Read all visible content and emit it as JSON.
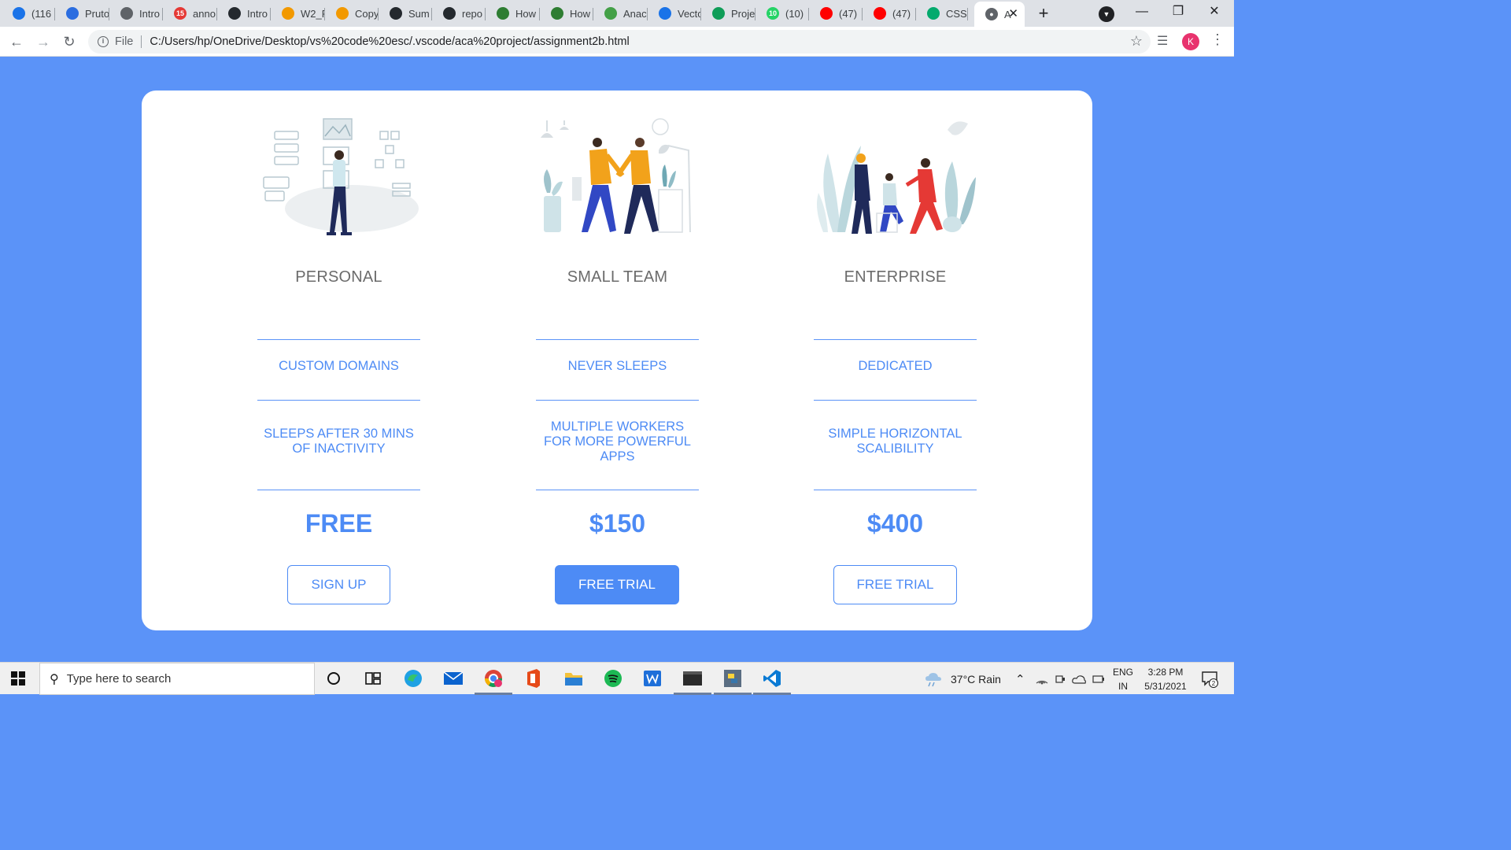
{
  "browser": {
    "tabs": [
      {
        "label": "(116",
        "color": "#1a73e8",
        "icon": "drive-icon"
      },
      {
        "label": "Pruto",
        "color": "#2b6de0",
        "icon": "code-icon"
      },
      {
        "label": "Intro",
        "color": "#5f6368",
        "icon": "globe-icon"
      },
      {
        "label": "anno",
        "color": "#e53935",
        "icon": "notification-icon",
        "badge": "15"
      },
      {
        "label": "Intro",
        "color": "#24292e",
        "icon": "github-icon"
      },
      {
        "label": "W2_F",
        "color": "#f29900",
        "icon": "colab-icon"
      },
      {
        "label": "Copy",
        "color": "#f29900",
        "icon": "colab-icon"
      },
      {
        "label": "Sum",
        "color": "#24292e",
        "icon": "github-icon"
      },
      {
        "label": "repo",
        "color": "#24292e",
        "icon": "github-icon"
      },
      {
        "label": "How",
        "color": "#2e7d32",
        "icon": "geeks-icon"
      },
      {
        "label": "How",
        "color": "#2e7d32",
        "icon": "geeks-icon"
      },
      {
        "label": "Anac",
        "color": "#43a047",
        "icon": "anaconda-icon"
      },
      {
        "label": "Vecto",
        "color": "#1a73e8",
        "icon": "c-icon"
      },
      {
        "label": "Proje",
        "color": "#0f9d58",
        "icon": "plus-icon"
      },
      {
        "label": "(10)",
        "color": "#25d366",
        "icon": "whatsapp-icon",
        "badge": "10"
      },
      {
        "label": "(47)",
        "color": "#ff0000",
        "icon": "youtube-icon"
      },
      {
        "label": "(47)",
        "color": "#ff0000",
        "icon": "youtube-icon"
      },
      {
        "label": "CSS",
        "color": "#04aa6d",
        "icon": "w3-icon"
      }
    ],
    "active_tab": {
      "label": "A",
      "icon": "globe-icon"
    },
    "address": {
      "scheme_label": "File",
      "url": "C:/Users/hp/OneDrive/Desktop/vs%20code%20esc/.vscode/aca%20project/assignment2b.html"
    },
    "profile_initial": "K"
  },
  "pricing": {
    "plans": [
      {
        "name": "PERSONAL",
        "features": [
          "CUSTOM DOMAINS",
          "SLEEPS AFTER 30 MINS OF INACTIVITY"
        ],
        "price": "FREE",
        "button": "SIGN UP",
        "button_style": "outline"
      },
      {
        "name": "SMALL TEAM",
        "features": [
          "NEVER SLEEPS",
          "MULTIPLE WORKERS FOR MORE POWERFUL APPS"
        ],
        "price": "$150",
        "button": "FREE TRIAL",
        "button_style": "filled"
      },
      {
        "name": "ENTERPRISE",
        "features": [
          "DEDICATED",
          "SIMPLE HORIZONTAL SCALIBILITY"
        ],
        "price": "$400",
        "button": "FREE TRIAL",
        "button_style": "outline"
      }
    ],
    "colors": {
      "accent": "#4d8bf5",
      "background": "#5b93f8",
      "card": "#ffffff"
    }
  },
  "taskbar": {
    "search_placeholder": "Type here to search",
    "weather": "37°C  Rain",
    "language": [
      "ENG",
      "IN"
    ],
    "time": "3:28 PM",
    "date": "5/31/2021",
    "notification_count": "2"
  }
}
